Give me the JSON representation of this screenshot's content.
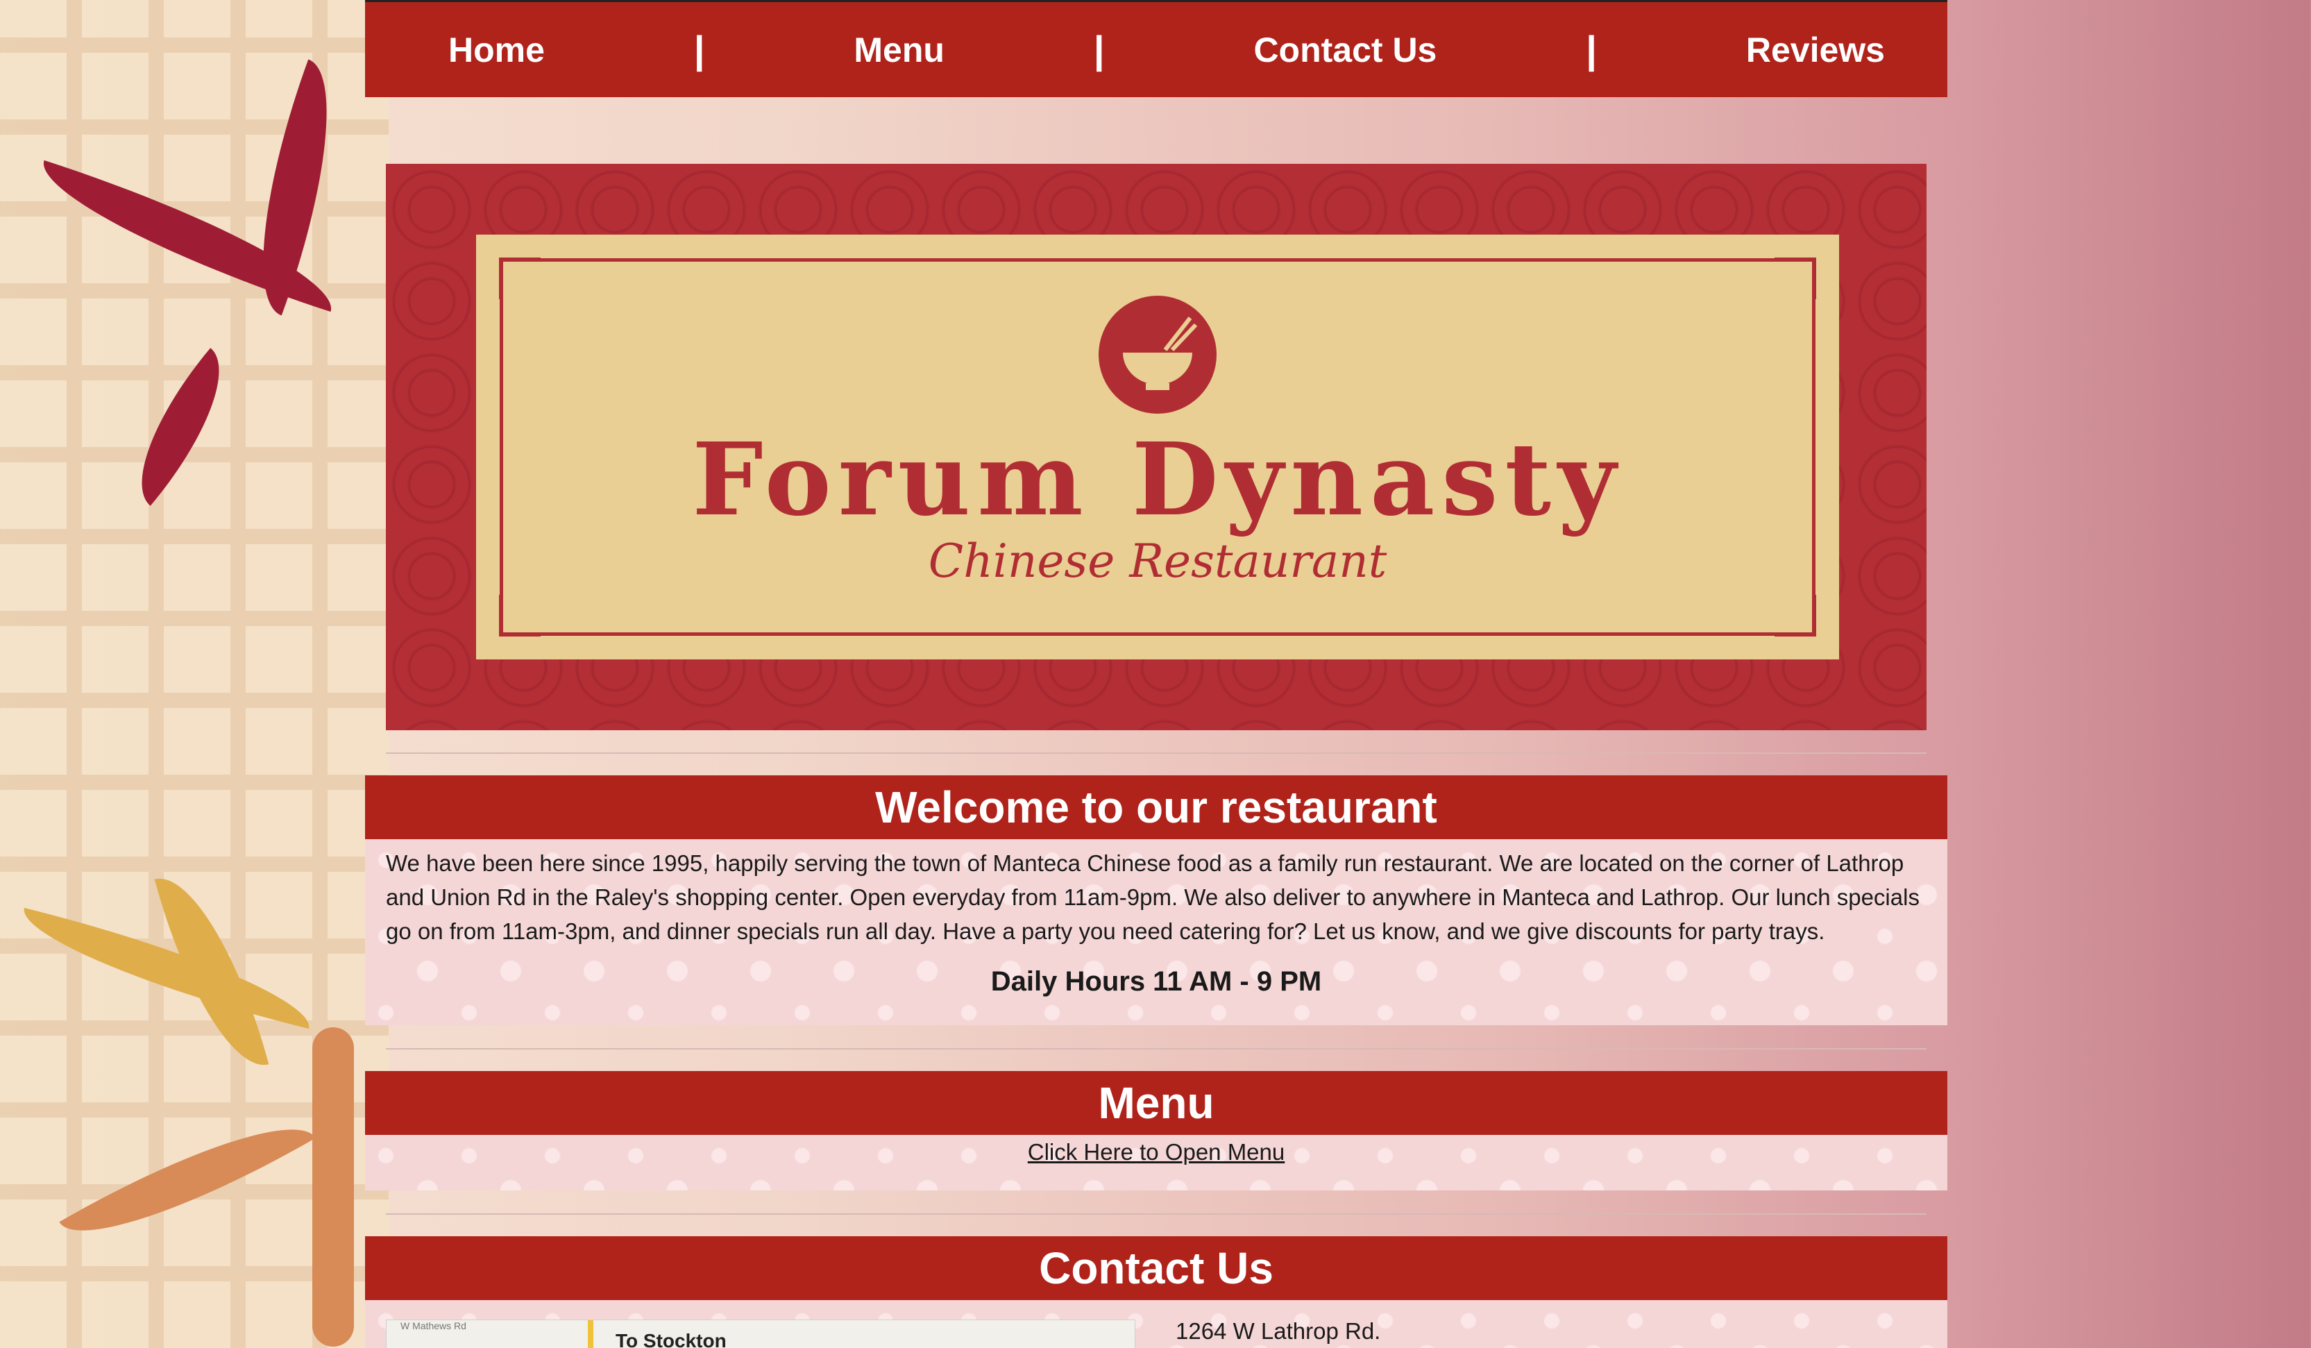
{
  "nav": {
    "items": [
      {
        "label": "Home"
      },
      {
        "label": "Menu"
      },
      {
        "label": "Contact Us"
      },
      {
        "label": "Reviews"
      }
    ],
    "separator": "|"
  },
  "banner": {
    "logo_icon": "bowl-chopsticks-icon",
    "brand_name": "Forum Dynasty",
    "tagline": "Chinese Restaurant"
  },
  "welcome": {
    "heading": "Welcome to our restaurant",
    "body": "We have been here since 1995, happily serving the town of Manteca Chinese food as a family run restaurant. We are located on the corner of Lathrop and Union Rd in the Raley's shopping center. Open everyday from 11am-9pm. We also deliver to anywhere in Manteca and Lathrop. Our lunch specials go on from 11am-3pm, and dinner specials run all day. Have a party you need catering for? Let us know, and we give discounts for party trays.",
    "hours": "Daily Hours 11 AM - 9 PM"
  },
  "menu_section": {
    "heading": "Menu",
    "link_text": "Click Here to Open Menu"
  },
  "contact": {
    "heading": "Contact Us",
    "map_street_small": "W Mathews Rd",
    "map_label": "To Stockton",
    "address_line1": "1264 W Lathrop Rd."
  },
  "colors": {
    "primary_red": "#b0231b",
    "banner_red": "#b32e35",
    "plaque_gold": "#e9cf94",
    "body_pink": "#f5d6d6"
  }
}
